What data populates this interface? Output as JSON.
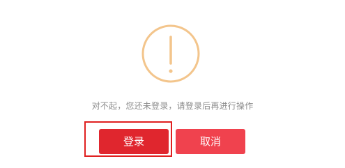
{
  "dialog": {
    "icon": "exclamation-circle-icon",
    "message": "对不起，您还未登录，请登录后再进行操作",
    "login_label": "登录",
    "cancel_label": "取消"
  },
  "colors": {
    "icon": "#f3c58c",
    "primary": "#e0262e",
    "secondary": "#f0424e",
    "highlight": "#e02020",
    "text": "#8c8c8c"
  }
}
